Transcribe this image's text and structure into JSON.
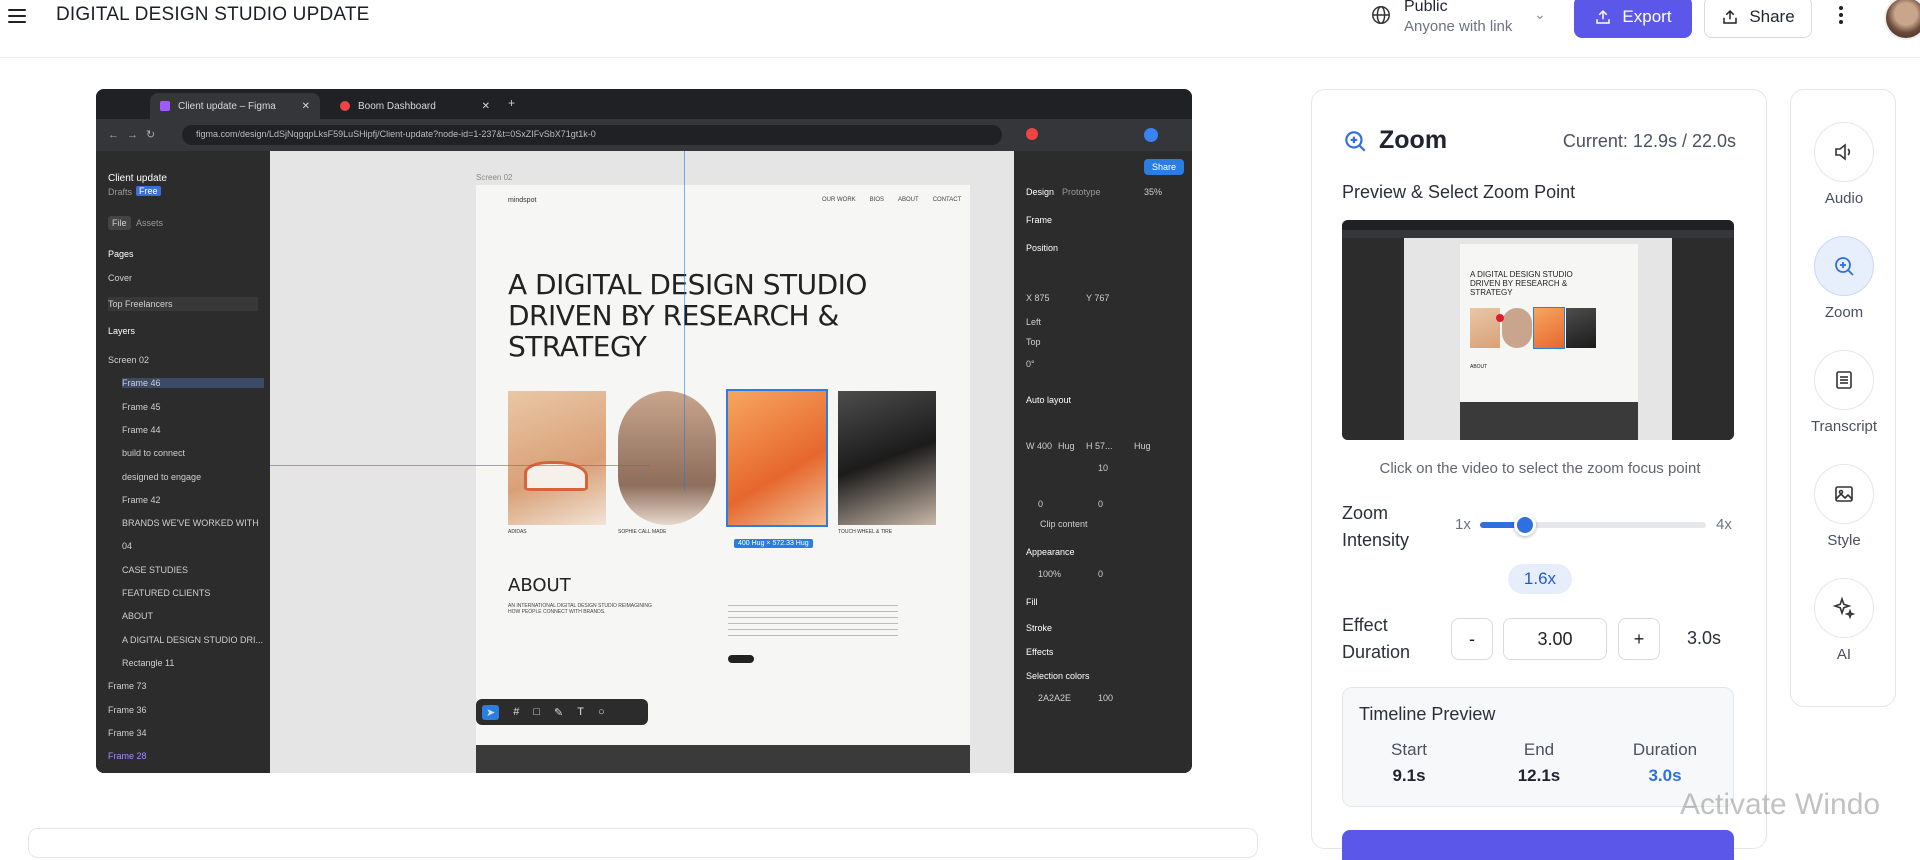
{
  "header": {
    "title": "DIGITAL DESIGN STUDIO UPDATE",
    "visibility_title": "Public",
    "visibility_sub": "Anyone with link",
    "export_label": "Export",
    "share_label": "Share"
  },
  "video": {
    "tabs": [
      "Client update – Figma",
      "Boom Dashboard"
    ],
    "url": "figma.com/design/LdSjNqgqpLksF59LuSHipfj/Client-update?node-id=1-237&t=0SxZIFvSbX71gt1k-0",
    "left_panel": {
      "file_name": "Client update",
      "drafts": "Drafts",
      "badge": "Free",
      "file_tab": "File",
      "assets_tab": "Assets",
      "pages_heading": "Pages",
      "pages": [
        "Cover",
        "Top Freelancers"
      ],
      "layers_heading": "Layers",
      "layers": [
        "Screen 02",
        "Frame 46",
        "Frame 45",
        "Frame 44",
        "build to connect",
        "designed to engage",
        "Frame 42",
        "BRANDS WE'VE WORKED WITH",
        "04",
        "CASE STUDIES",
        "FEATURED CLIENTS",
        "ABOUT",
        "A DIGITAL DESIGN STUDIO DRI...",
        "Rectangle 11",
        "Frame 73",
        "Frame 36",
        "Frame 34",
        "Frame 28"
      ]
    },
    "canvas": {
      "frame_label": "Screen 02",
      "logo": "mindspot",
      "nav": [
        "OUR WORK",
        "BIOS",
        "ABOUT",
        "CONTACT"
      ],
      "hero": "A DIGITAL DESIGN STUDIO DRIVEN BY RESEARCH & STRATEGY",
      "about": "ABOUT",
      "about_sub": "AN INTERNATIONAL DIGITAL DESIGN STUDIO REIMAGINING HOW PEOPLE CONNECT WITH BRANDS.",
      "captions": [
        "ADIDAS",
        "SOPHIE CALL MADE",
        "",
        "TOUCH WHEEL & TIRE"
      ],
      "selection_badge": "400 Hug × 572.33 Hug"
    },
    "right_panel": {
      "share": "Share",
      "design_tab": "Design",
      "prototype_tab": "Prototype",
      "zoom": "35%",
      "frame": "Frame",
      "position": "Position",
      "x": "X 875",
      "y": "Y 767",
      "left": "Left",
      "top": "Top",
      "rotation": "0°",
      "auto_layout": "Auto layout",
      "w": "W 400",
      "w_mode": "Hug",
      "h": "H 57...",
      "h_mode": "Hug",
      "gap": "10",
      "pad_x": "0",
      "pad_y": "0",
      "clip": "Clip content",
      "appearance": "Appearance",
      "opacity": "100%",
      "radius": "0",
      "fill": "Fill",
      "stroke": "Stroke",
      "effects": "Effects",
      "selection_colors": "Selection colors",
      "swatch_hex": "2A2A2E",
      "swatch_pct": "100"
    }
  },
  "zoom_panel": {
    "title": "Zoom",
    "current": "Current: 12.9s / 22.0s",
    "preview_label": "Preview & Select Zoom Point",
    "hint": "Click on the video to select the zoom focus point",
    "intensity_label": "Zoom Intensity",
    "min_label": "1x",
    "max_label": "4x",
    "intensity_value": "1.6x",
    "intensity_min": 1,
    "intensity_max": 4,
    "intensity": 1.6,
    "duration_label": "Effect Duration",
    "minus": "-",
    "plus": "+",
    "duration_input": "3.00",
    "duration_value": "3.0s",
    "timeline": {
      "title": "Timeline Preview",
      "start_label": "Start",
      "start": "9.1s",
      "end_label": "End",
      "end": "12.1s",
      "duration_label": "Duration",
      "duration": "3.0s"
    }
  },
  "rail": {
    "items": [
      "Audio",
      "Zoom",
      "Transcript",
      "Style",
      "AI"
    ],
    "active": "Zoom"
  },
  "watermark": "Activate Windo",
  "colors": {
    "accent": "#5b57e8",
    "blue": "#2f6fe0",
    "figma_selection": "#2a7de1"
  }
}
